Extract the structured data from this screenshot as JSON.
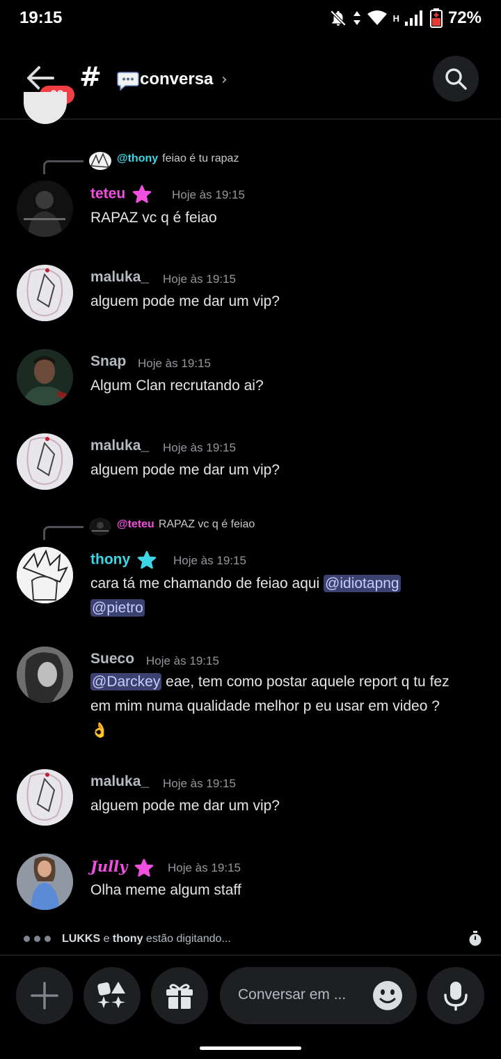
{
  "status_bar": {
    "time": "19:15",
    "network": "H",
    "battery": "72%"
  },
  "header": {
    "badge": "99",
    "hash": "#",
    "channel": "conversa",
    "chevron": "›"
  },
  "messages": [
    {
      "reply": {
        "name": "@thony",
        "text": "feiao é tu rapaz",
        "name_color": "#3dd6e6"
      },
      "user": "teteu",
      "user_color": "#f24ee0",
      "star_color": "#f24ee0",
      "time": "Hoje às 19:15",
      "lines": [
        "RAPAZ vc q é feiao"
      ]
    },
    {
      "user": "maluka_",
      "user_color": "#b5bac1",
      "time": "Hoje às 19:15",
      "lines": [
        "alguem pode me dar um vip?"
      ]
    },
    {
      "user": "Snap",
      "user_color": "#b5bac1",
      "time": "Hoje às 19:15",
      "lines": [
        "Algum Clan recrutando ai?"
      ]
    },
    {
      "user": "maluka_",
      "user_color": "#b5bac1",
      "time": "Hoje às 19:15",
      "lines": [
        "alguem pode me dar um vip?"
      ]
    },
    {
      "reply": {
        "name": "@teteu",
        "text": "RAPAZ vc q é feiao",
        "name_color": "#f24ee0"
      },
      "user": "thony",
      "user_color": "#3dd6e6",
      "star_color": "#3dd6e6",
      "time": "Hoje às 19:15",
      "line1_text": "cara tá me chamando de feiao aqui ",
      "mention1": "@idiotapng",
      "mention2": "@pietro"
    },
    {
      "user": "Sueco",
      "user_color": "#b5bac1",
      "time": "Hoje às 19:15",
      "mention": "@Darckey",
      "line1_text": " eae, tem como postar aquele report q tu fez",
      "line2": "em mim numa qualidade melhor p eu usar em video ?",
      "emoji": "👌"
    },
    {
      "user": "maluka_",
      "user_color": "#b5bac1",
      "time": "Hoje às 19:15",
      "lines": [
        "alguem pode me dar um vip?"
      ]
    },
    {
      "user": "Jully",
      "user_color": "#f24ee0",
      "star_color": "#f24ee0",
      "time": "Hoje às 19:15",
      "lines": [
        "Olha meme algum staff"
      ]
    }
  ],
  "typing": {
    "user1": "LUKKS",
    "connector": "e",
    "user2": "thony",
    "suffix": "estão digitando..."
  },
  "composer": {
    "placeholder": "Conversar em ..."
  },
  "colors": {
    "background": "#000000",
    "mention_bg": "#3c4270",
    "badge": "#f23f43",
    "button_bg": "#1e1f22"
  }
}
